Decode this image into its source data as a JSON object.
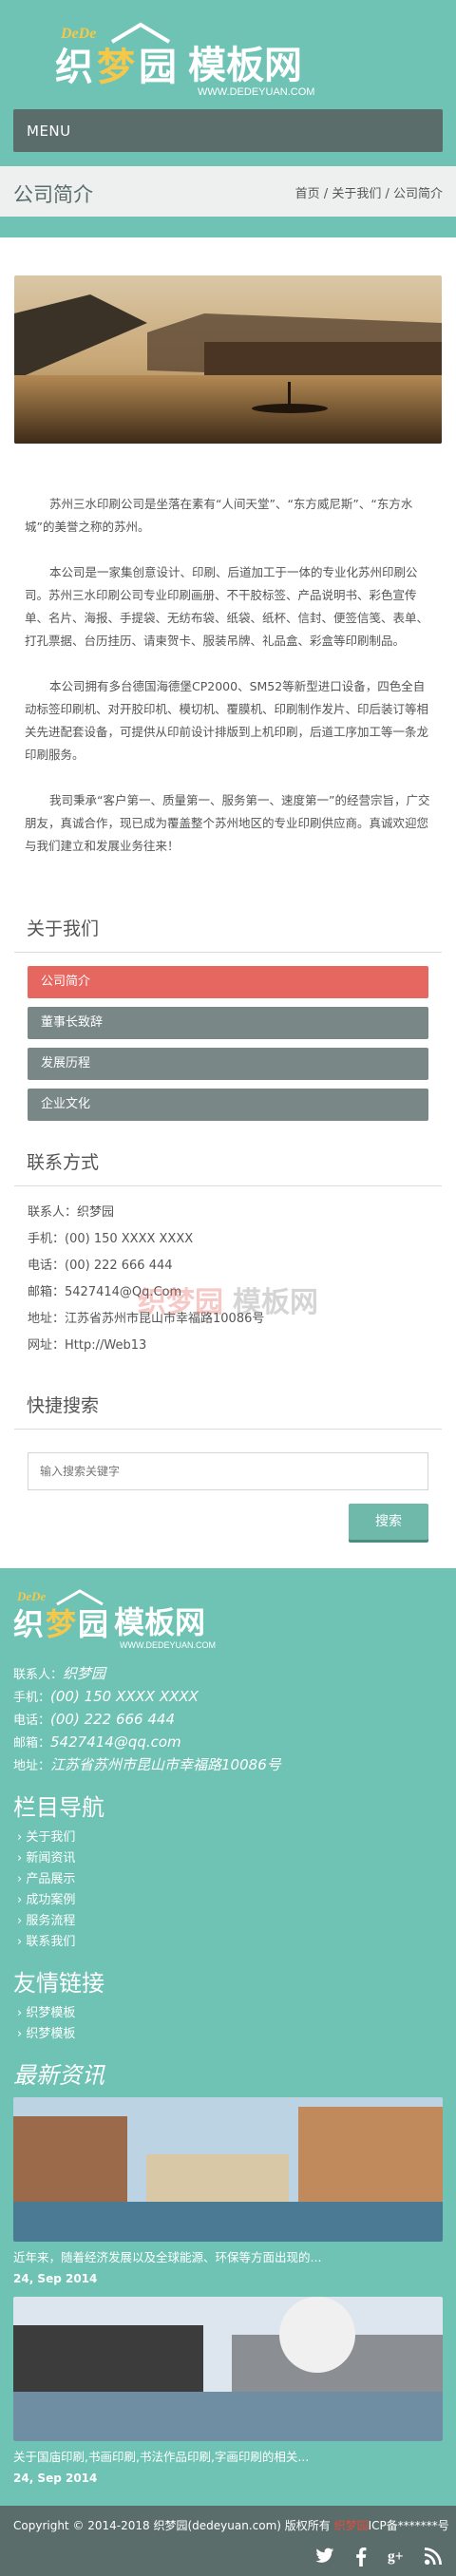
{
  "header": {
    "logo_brand": "DeDe 织梦园模板网",
    "logo_url": "WWW.DEDEYUAN.COM",
    "menu_label": "MENU",
    "page_title": "公司简介",
    "breadcrumb": [
      "首页",
      "关于我们",
      "公司简介"
    ],
    "breadcrumb_sep": " / "
  },
  "article": {
    "paragraphs": [
      "苏州三水印刷公司是坐落在素有“人间天堂”、“东方威尼斯”、“东方水城”的美誉之称的苏州。",
      "本公司是一家集创意设计、印刷、后道加工于一体的专业化苏州印刷公司。苏州三水印刷公司专业印刷画册、不干胶标签、产品说明书、彩色宣传单、名片、海报、手提袋、无纺布袋、纸袋、纸杯、信封、便签信笺、表单、打孔票据、台历挂历、请柬贺卡、服装吊牌、礼品盒、彩盒等印刷制品。",
      "本公司拥有多台德国海德堡CP2000、SM52等新型进口设备，四色全自动标签印刷机、对开胶印机、模切机、覆膜机、印刷制作发片、印后装订等相关先进配套设备，可提供从印前设计排版到上机印刷，后道工序加工等一条龙印刷服务。",
      "我司秉承“客户第一、质量第一、服务第一、速度第一”的经营宗旨，广交朋友，真诚合作，现已成为覆盖整个苏州地区的专业印刷供应商。真诚欢迎您与我们建立和发展业务往来！"
    ]
  },
  "sidebar": {
    "about_title": "关于我们",
    "items": [
      {
        "label": "公司简介",
        "active": true
      },
      {
        "label": "董事长致辞",
        "active": false
      },
      {
        "label": "发展历程",
        "active": false
      },
      {
        "label": "企业文化",
        "active": false
      }
    ],
    "contact_title": "联系方式",
    "contact": {
      "person": "联系人：织梦园",
      "mobile": "手机：(00) 150 XXXX XXXX",
      "phone": "电话：(00) 222 666 444",
      "email": "邮箱：5427414@Qq.Com",
      "address": "地址：江苏省苏州市昆山市幸福路10086号",
      "website": "网址：Http://Web13"
    },
    "search_title": "快捷搜索",
    "search_placeholder": "输入搜索关键字",
    "search_button": "搜索"
  },
  "footer": {
    "contact_label": "联系人：",
    "contact_value": "织梦园",
    "mobile_label": "手机：",
    "mobile_value": "(00) 150 XXXX XXXX",
    "phone_label": "电话：",
    "phone_value": "(00) 222 666 444",
    "email_label": "邮箱：",
    "email_value": "5427414@qq.com",
    "address_label": "地址：",
    "address_value": "江苏省苏州市昆山市幸福路10086号",
    "nav_title": "栏目导航",
    "nav_items": [
      "关于我们",
      "新闻资讯",
      "产品展示",
      "成功案例",
      "服务流程",
      "联系我们"
    ],
    "links_title": "友情链接",
    "links": [
      "织梦模板",
      "织梦模板"
    ],
    "news_title": "最新资讯",
    "news": [
      {
        "text": "近年来，随着经济发展以及全球能源、环保等方面出现的...",
        "date": "24, Sep 2014"
      },
      {
        "text": "关于国庙印刷,书画印刷,书法作品印刷,字画印刷的相关...",
        "date": "24, Sep 2014"
      }
    ],
    "copyright_pre": "Copyright © 2014-2018 织梦园(dedeyuan.com) 版权所有 ",
    "copyright_red": "织梦园",
    "copyright_post": "ICP备*******号"
  },
  "colors": {
    "accent": "#6fc3b4",
    "menu_bg": "#5a6d6b",
    "active_item": "#e66660",
    "side_item": "#7a8787"
  },
  "icons": [
    "twitter-icon",
    "facebook-icon",
    "google-plus-icon",
    "rss-icon"
  ]
}
